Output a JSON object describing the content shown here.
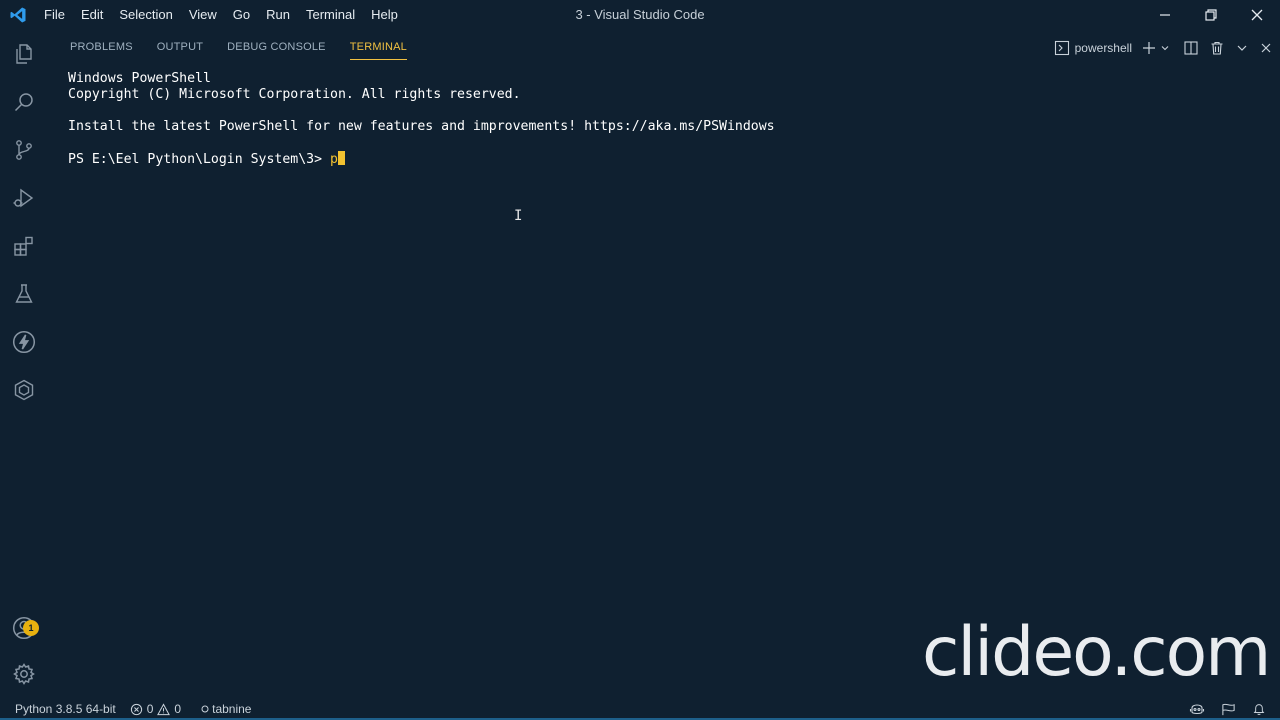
{
  "window": {
    "title": "3 - Visual Studio Code"
  },
  "menu": [
    "File",
    "Edit",
    "Selection",
    "View",
    "Go",
    "Run",
    "Terminal",
    "Help"
  ],
  "activity_bar": [
    {
      "name": "explorer-icon"
    },
    {
      "name": "search-icon"
    },
    {
      "name": "source-control-icon"
    },
    {
      "name": "run-debug-icon"
    },
    {
      "name": "extensions-icon"
    },
    {
      "name": "testing-icon"
    },
    {
      "name": "lightning-icon"
    },
    {
      "name": "cube-icon"
    }
  ],
  "accounts": {
    "badge": "1"
  },
  "panel": {
    "tabs": [
      "PROBLEMS",
      "OUTPUT",
      "DEBUG CONSOLE",
      "TERMINAL"
    ],
    "active_tab": "TERMINAL",
    "shell_label": "powershell"
  },
  "terminal": {
    "lines": [
      "Windows PowerShell",
      "Copyright (C) Microsoft Corporation. All rights reserved.",
      "",
      "Install the latest PowerShell for new features and improvements! https://aka.ms/PSWindows",
      ""
    ],
    "prompt": "PS E:\\Eel Python\\Login System\\3> ",
    "input": "p"
  },
  "status_bar": {
    "interpreter": "Python 3.8.5 64-bit",
    "errors": "0",
    "warnings": "0",
    "tabnine": "tabnine"
  },
  "watermark": "clideo.com",
  "colors": {
    "background": "#0f2030",
    "accent": "#f0c041",
    "text": "#ffffff"
  }
}
